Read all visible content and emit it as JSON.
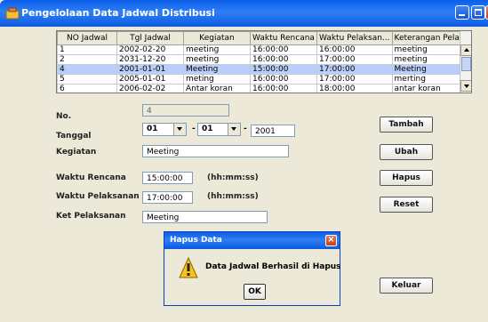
{
  "window": {
    "title": "Pengelolaan Data Jadwal Distribusi"
  },
  "table": {
    "columns": [
      "NO Jadwal",
      "Tgl Jadwal",
      "Kegiatan",
      "Waktu Rencana",
      "Waktu Pelaksan...",
      "Keterangan Pela..."
    ],
    "rows": [
      [
        "1",
        "2002-02-20",
        "meeting",
        "16:00:00",
        "16:00:00",
        "meeting"
      ],
      [
        "2",
        "2031-12-20",
        "meeting",
        "16:00:00",
        "17:00:00",
        "meeting"
      ],
      [
        "4",
        "2001-01-01",
        "Meeting",
        "15:00:00",
        "17:00:00",
        "Meeting"
      ],
      [
        "5",
        "2005-01-01",
        "meting",
        "16:00:00",
        "17:00:00",
        "merting"
      ],
      [
        "6",
        "2006-02-02",
        "Antar koran",
        "16:00:00",
        "18:00:00",
        "antar koran"
      ]
    ],
    "selected_index": 2
  },
  "form": {
    "no_label": "No.",
    "no_value": "4",
    "tanggal_label": "Tanggal",
    "day": "01",
    "month": "01",
    "date_sep": "-",
    "year": "2001",
    "kegiatan_label": "Kegiatan",
    "kegiatan_value": "Meeting",
    "waktu_rencana_label": "Waktu Rencana",
    "waktu_rencana_value": "15:00:00",
    "waktu_rencana_hint": "(hh:mm:ss)",
    "waktu_pelaksanan_label": "Waktu Pelaksanan",
    "waktu_pelaksanan_value": "17:00:00",
    "waktu_pelaksanan_hint": "(hh:mm:ss)",
    "ket_label": "Ket Pelaksanan",
    "ket_value": "Meeting"
  },
  "buttons": {
    "tambah": "Tambah",
    "ubah": "Ubah",
    "hapus": "Hapus",
    "reset": "Reset",
    "keluar": "Keluar"
  },
  "dialog": {
    "title": "Hapus Data",
    "message": "Data Jadwal Berhasil di Hapus",
    "ok": "OK"
  },
  "colors": {
    "titlebar": "#0a5ee8",
    "selection": "#b8cffb",
    "window_bg": "#ece9d8"
  }
}
